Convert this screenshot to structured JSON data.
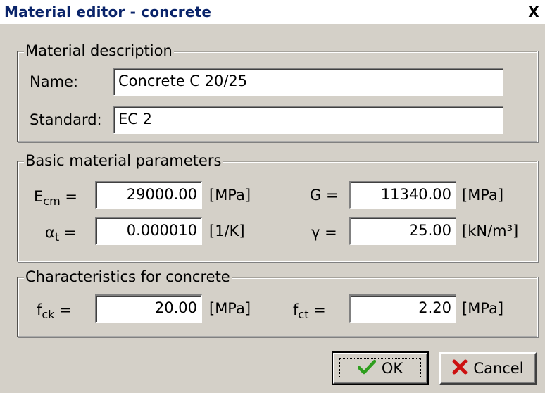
{
  "window": {
    "title": "Material editor - concrete",
    "close_glyph": "X"
  },
  "description": {
    "legend": "Material description",
    "name_label": "Name:",
    "name_value": "Concrete C 20/25",
    "standard_label": "Standard:",
    "standard_value": "EC 2"
  },
  "basic": {
    "legend": "Basic material parameters",
    "ecm": {
      "base": "E",
      "sub": "cm",
      "eq": " =",
      "value": "29000.00",
      "unit": "[MPa]"
    },
    "g": {
      "text": "G =",
      "value": "11340.00",
      "unit": "[MPa]"
    },
    "alpha": {
      "base": "α",
      "sub": "t",
      "eq": " =",
      "value": "0.000010",
      "unit": "[1/K]"
    },
    "gamma": {
      "text": "γ =",
      "value": "25.00",
      "unit": "[kN/m³]"
    }
  },
  "characteristics": {
    "legend": "Characteristics for concrete",
    "fck": {
      "base": "f",
      "sub": "ck",
      "eq": " =",
      "value": "20.00",
      "unit": "[MPa]"
    },
    "fct": {
      "base": "f",
      "sub": "ct",
      "eq": " =",
      "value": "2.20",
      "unit": "[MPa]"
    }
  },
  "buttons": {
    "ok_label": "OK",
    "cancel_label": "Cancel"
  },
  "colors": {
    "dialog_bg": "#d4d0c8",
    "title_text": "#0a246a",
    "ok_check": "#2e9e1e",
    "cancel_x": "#cc1010"
  }
}
